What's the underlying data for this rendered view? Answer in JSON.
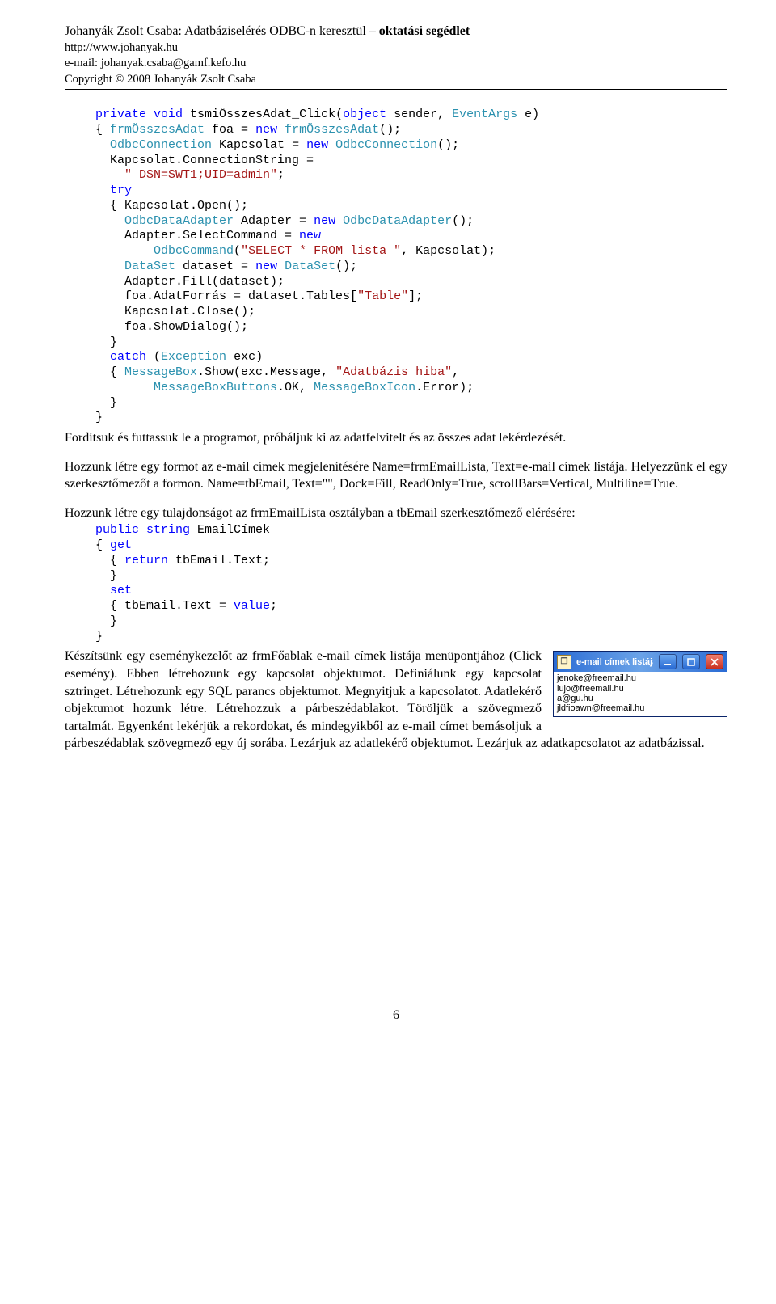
{
  "header": {
    "title_plain": "Johanyák Zsolt Csaba: Adatbáziselérés ODBC-n keresztül",
    "title_bold": "– oktatási segédlet",
    "url": "http://www.johanyak.hu",
    "email": "e-mail: johanyak.csaba@gamf.kefo.hu",
    "copyright": "Copyright © 2008 Johanyák Zsolt Csaba"
  },
  "code1_tokens": [
    {
      "c": "c-kw",
      "t": "private"
    },
    {
      "c": "c-text",
      "t": " "
    },
    {
      "c": "c-kw",
      "t": "void"
    },
    {
      "c": "c-text",
      "t": " tsmiÖsszesAdat_Click("
    },
    {
      "c": "c-kw",
      "t": "object"
    },
    {
      "c": "c-text",
      "t": " sender, "
    },
    {
      "c": "c-type",
      "t": "EventArgs"
    },
    {
      "c": "c-text",
      "t": " e)"
    },
    {
      "c": "nl"
    },
    {
      "c": "c-text",
      "t": "{ "
    },
    {
      "c": "c-type",
      "t": "frmÖsszesAdat"
    },
    {
      "c": "c-text",
      "t": " foa = "
    },
    {
      "c": "c-kw",
      "t": "new"
    },
    {
      "c": "c-text",
      "t": " "
    },
    {
      "c": "c-type",
      "t": "frmÖsszesAdat"
    },
    {
      "c": "c-text",
      "t": "();"
    },
    {
      "c": "nl"
    },
    {
      "c": "c-text",
      "t": "  "
    },
    {
      "c": "c-type",
      "t": "OdbcConnection"
    },
    {
      "c": "c-text",
      "t": " Kapcsolat = "
    },
    {
      "c": "c-kw",
      "t": "new"
    },
    {
      "c": "c-text",
      "t": " "
    },
    {
      "c": "c-type",
      "t": "OdbcConnection"
    },
    {
      "c": "c-text",
      "t": "();"
    },
    {
      "c": "nl"
    },
    {
      "c": "c-text",
      "t": "  Kapcsolat.ConnectionString ="
    },
    {
      "c": "nl"
    },
    {
      "c": "c-text",
      "t": "    "
    },
    {
      "c": "c-str",
      "t": "\" DSN=SWT1;UID=admin\""
    },
    {
      "c": "c-text",
      "t": ";"
    },
    {
      "c": "nl"
    },
    {
      "c": "c-text",
      "t": "  "
    },
    {
      "c": "c-kw",
      "t": "try"
    },
    {
      "c": "nl"
    },
    {
      "c": "c-text",
      "t": "  { Kapcsolat.Open();"
    },
    {
      "c": "nl"
    },
    {
      "c": "c-text",
      "t": "    "
    },
    {
      "c": "c-type",
      "t": "OdbcDataAdapter"
    },
    {
      "c": "c-text",
      "t": " Adapter = "
    },
    {
      "c": "c-kw",
      "t": "new"
    },
    {
      "c": "c-text",
      "t": " "
    },
    {
      "c": "c-type",
      "t": "OdbcDataAdapter"
    },
    {
      "c": "c-text",
      "t": "();"
    },
    {
      "c": "nl"
    },
    {
      "c": "c-text",
      "t": "    Adapter.SelectCommand = "
    },
    {
      "c": "c-kw",
      "t": "new"
    },
    {
      "c": "nl"
    },
    {
      "c": "c-text",
      "t": "        "
    },
    {
      "c": "c-type",
      "t": "OdbcCommand"
    },
    {
      "c": "c-text",
      "t": "("
    },
    {
      "c": "c-str",
      "t": "\"SELECT * FROM lista \""
    },
    {
      "c": "c-text",
      "t": ", Kapcsolat);"
    },
    {
      "c": "nl"
    },
    {
      "c": "c-text",
      "t": "    "
    },
    {
      "c": "c-type",
      "t": "DataSet"
    },
    {
      "c": "c-text",
      "t": " dataset = "
    },
    {
      "c": "c-kw",
      "t": "new"
    },
    {
      "c": "c-text",
      "t": " "
    },
    {
      "c": "c-type",
      "t": "DataSet"
    },
    {
      "c": "c-text",
      "t": "();"
    },
    {
      "c": "nl"
    },
    {
      "c": "c-text",
      "t": "    Adapter.Fill(dataset);"
    },
    {
      "c": "nl"
    },
    {
      "c": "c-text",
      "t": "    foa.AdatForrás = dataset.Tables["
    },
    {
      "c": "c-str",
      "t": "\"Table\""
    },
    {
      "c": "c-text",
      "t": "];"
    },
    {
      "c": "nl"
    },
    {
      "c": "c-text",
      "t": "    Kapcsolat.Close();"
    },
    {
      "c": "nl"
    },
    {
      "c": "c-text",
      "t": "    foa.ShowDialog();"
    },
    {
      "c": "nl"
    },
    {
      "c": "c-text",
      "t": "  }"
    },
    {
      "c": "nl"
    },
    {
      "c": "c-text",
      "t": "  "
    },
    {
      "c": "c-kw",
      "t": "catch"
    },
    {
      "c": "c-text",
      "t": " ("
    },
    {
      "c": "c-type",
      "t": "Exception"
    },
    {
      "c": "c-text",
      "t": " exc)"
    },
    {
      "c": "nl"
    },
    {
      "c": "c-text",
      "t": "  { "
    },
    {
      "c": "c-type",
      "t": "MessageBox"
    },
    {
      "c": "c-text",
      "t": ".Show(exc.Message, "
    },
    {
      "c": "c-str",
      "t": "\"Adatbázis hiba\""
    },
    {
      "c": "c-text",
      "t": ","
    },
    {
      "c": "nl"
    },
    {
      "c": "c-text",
      "t": "        "
    },
    {
      "c": "c-type",
      "t": "MessageBoxButtons"
    },
    {
      "c": "c-text",
      "t": ".OK, "
    },
    {
      "c": "c-type",
      "t": "MessageBoxIcon"
    },
    {
      "c": "c-text",
      "t": ".Error);"
    },
    {
      "c": "nl"
    },
    {
      "c": "c-text",
      "t": "  }"
    },
    {
      "c": "nl"
    },
    {
      "c": "c-text",
      "t": "}"
    }
  ],
  "para1": "Fordítsuk és futtassuk le a programot, próbáljuk ki az adatfelvitelt és az összes adat lekérdezését.",
  "para2": "Hozzunk létre egy formot az e-mail címek megjelenítésére Name=frmEmailLista, Text=e-mail címek listája. Helyezzünk el egy szerkesztőmezőt a formon. Name=tbEmail, Text=\"\", Dock=Fill, ReadOnly=True, scrollBars=Vertical, Multiline=True.",
  "para3": "Hozzunk létre egy tulajdonságot az frmEmailLista osztályban a tbEmail szerkesztőmező elérésére:",
  "code2_tokens": [
    {
      "c": "c-kw",
      "t": "public"
    },
    {
      "c": "c-text",
      "t": " "
    },
    {
      "c": "c-kw",
      "t": "string"
    },
    {
      "c": "c-text",
      "t": " EmailCímek"
    },
    {
      "c": "nl"
    },
    {
      "c": "c-text",
      "t": "{ "
    },
    {
      "c": "c-kw",
      "t": "get"
    },
    {
      "c": "nl"
    },
    {
      "c": "c-text",
      "t": "  { "
    },
    {
      "c": "c-kw",
      "t": "return"
    },
    {
      "c": "c-text",
      "t": " tbEmail.Text;"
    },
    {
      "c": "nl"
    },
    {
      "c": "c-text",
      "t": "  }"
    },
    {
      "c": "nl"
    },
    {
      "c": "c-text",
      "t": "  "
    },
    {
      "c": "c-kw",
      "t": "set"
    },
    {
      "c": "nl"
    },
    {
      "c": "c-text",
      "t": "  { tbEmail.Text = "
    },
    {
      "c": "c-kw",
      "t": "value"
    },
    {
      "c": "c-text",
      "t": ";"
    },
    {
      "c": "nl"
    },
    {
      "c": "c-text",
      "t": "  }"
    },
    {
      "c": "nl"
    },
    {
      "c": "c-text",
      "t": "}"
    }
  ],
  "para4": "Készítsünk egy eseménykezelőt az frmFőablak e-mail címek listája menüpontjához (Click esemény). Ebben létrehozunk egy kapcsolat objektumot. Definiálunk egy kapcsolat sztringet. Létrehozunk egy SQL parancs objektumot. Megnyitjuk a kapcsolatot. Adatlekérő objektumot hozunk létre. Létrehozzuk a párbeszédablakot. Töröljük a szövegmező tartalmát. Egyenként lekérjük a rekordokat, és mindegyikből az e-mail címet bemásoljuk a párbeszédablak szövegmező egy új sorába. Lezárjuk az adatlekérő objektumot. Lezárjuk az adatkapcsolatot az adatbázissal.",
  "window": {
    "title": "e-mail címek listája",
    "items": [
      "jenoke@freemail.hu",
      "lujo@freemail.hu",
      "a@gu.hu",
      "jldfioawn@freemail.hu"
    ]
  },
  "page_number": "6"
}
